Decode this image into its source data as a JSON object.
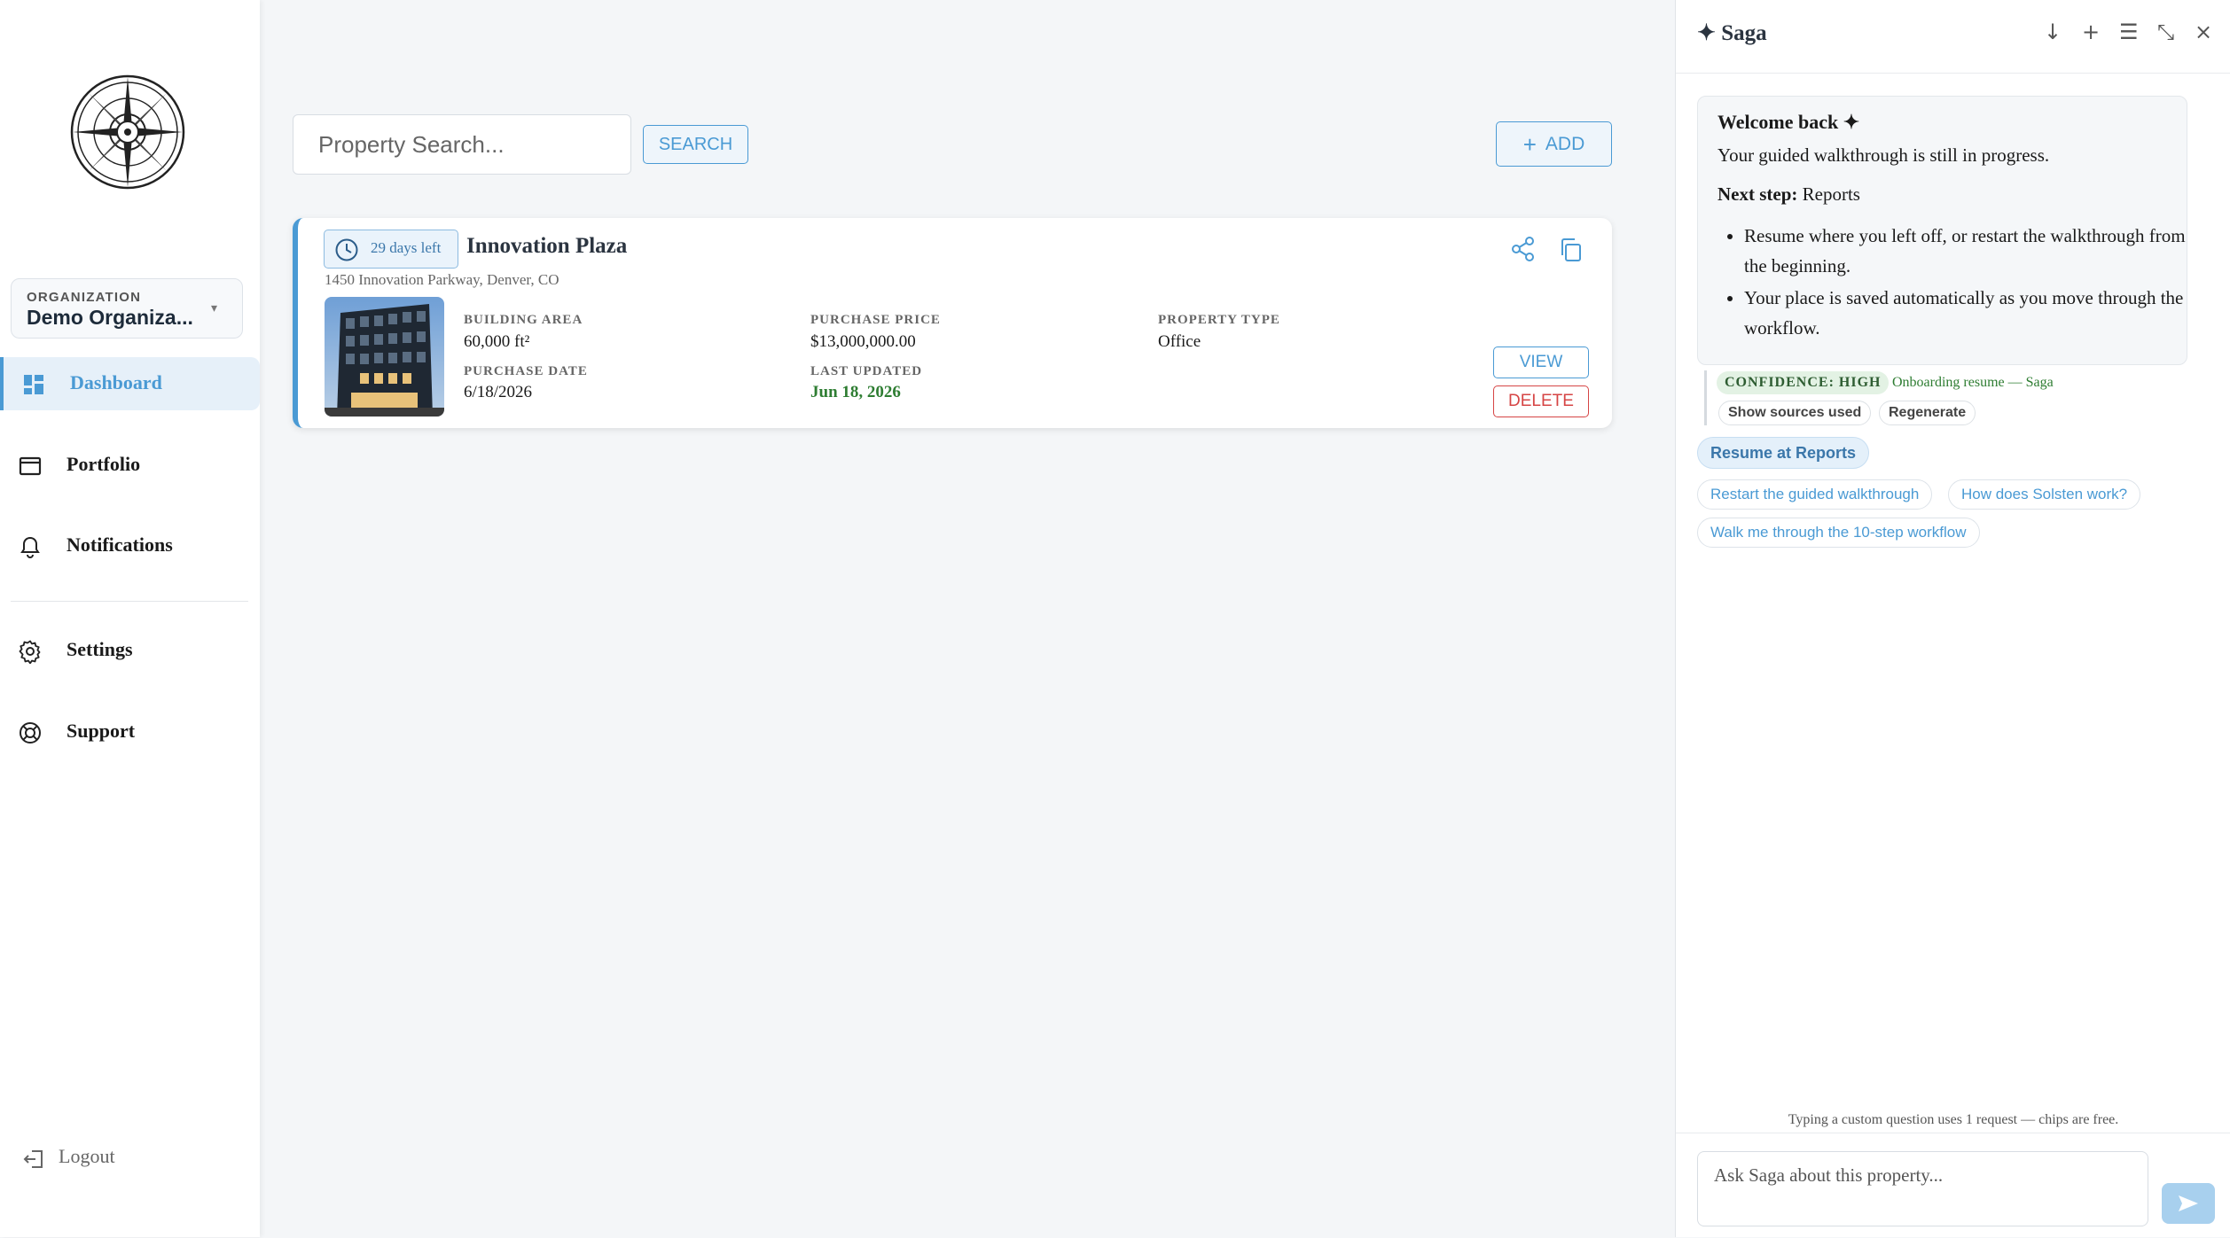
{
  "sidebar": {
    "organization": {
      "label": "ORGANIZATION",
      "value": "Demo Organiza..."
    },
    "nav": [
      {
        "label": "Dashboard",
        "icon": "dashboard-icon",
        "active": true
      },
      {
        "label": "Portfolio",
        "icon": "portfolio-icon"
      },
      {
        "label": "Notifications",
        "icon": "bell-icon"
      },
      {
        "label": "Settings",
        "icon": "gear-icon"
      },
      {
        "label": "Support",
        "icon": "lifebuoy-icon"
      }
    ],
    "logout": "Logout"
  },
  "main": {
    "search": {
      "placeholder": "Property Search...",
      "button": "SEARCH"
    },
    "add_button": "ADD",
    "property": {
      "days_left": "29 days left",
      "title": "Innovation Plaza",
      "address": "1450 Innovation Parkway, Denver, CO",
      "building_area_label": "BUILDING AREA",
      "building_area": "60,000 ft²",
      "purchase_price_label": "PURCHASE PRICE",
      "purchase_price": "$13,000,000.00",
      "property_type_label": "PROPERTY TYPE",
      "property_type": "Office",
      "purchase_date_label": "PURCHASE DATE",
      "purchase_date": "6/18/2026",
      "last_updated_label": "LAST UPDATED",
      "last_updated": "Jun 18, 2026",
      "view_button": "VIEW",
      "delete_button": "DELETE"
    }
  },
  "saga": {
    "title": "✦ Saga",
    "message": {
      "title": "Welcome back ✦",
      "line1": "Your guided walkthrough is still in progress.",
      "next_step_label": "Next step:",
      "next_step_value": "Reports",
      "bullets": [
        "Resume where you left off, or restart the walkthrough from the beginning.",
        "Your place is saved automatically as you move through the workflow."
      ]
    },
    "confidence": "CONFIDENCE: HIGH",
    "source": "Onboarding resume — Saga",
    "show_sources": "Show sources used",
    "regenerate": "Regenerate",
    "primary_chip": "Resume at Reports",
    "chips": [
      "Restart the guided walkthrough",
      "How does Solsten work?",
      "Walk me through the 10-step workflow"
    ],
    "footnote": "Typing a custom question uses 1 request — chips are free.",
    "input_placeholder": "Ask Saga about this property..."
  },
  "colors": {
    "accent": "#4a9ad4",
    "danger": "#d64545",
    "success": "#2e7d32"
  }
}
